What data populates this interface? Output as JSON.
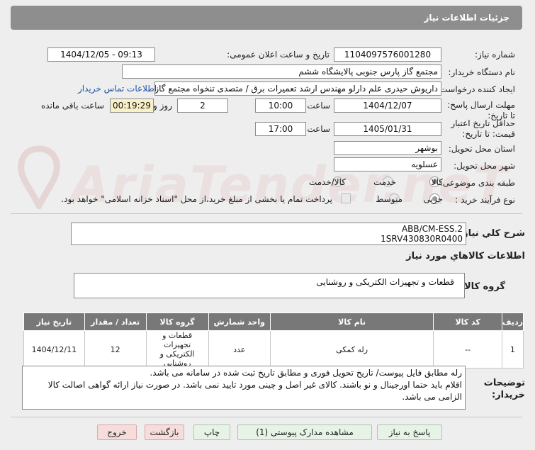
{
  "header": {
    "title": "جزئیات اطلاعات نیاز"
  },
  "fields": {
    "need_number_label": "شماره نیاز:",
    "need_number": "1104097576001280",
    "announce_label": "تاریخ و ساعت اعلان عمومی:",
    "announce_value": "1404/12/05 - 09:13",
    "buyer_org_label": "نام دستگاه خریدار:",
    "buyer_org": "مجتمع گاز پارس جنوبی  پالایشگاه ششم",
    "creator_label": "ایجاد کننده درخواست:",
    "creator": "داریوش حیدری علم دارلو مهندس ارشد تعمیرات برق / متصدی تنخواه مجتمع گاز",
    "contact_link": "اطلاعات تماس خریدار",
    "deadline_label": "مهلت ارسال پاسخ: تا تاریخ:",
    "deadline_date": "1404/12/07",
    "time_label": "ساعت",
    "deadline_time": "10:00",
    "days_value": "2",
    "days_label": "روز و",
    "remaining_time": "00:19:29",
    "remaining_label": "ساعت باقی مانده",
    "validity_label": "حداقل تاریخ اعتبار قیمت: تا تاریخ:",
    "validity_date": "1405/01/31",
    "validity_time": "17:00",
    "province_label": "استان محل تحویل:",
    "province": "بوشهر",
    "city_label": "شهر محل تحویل:",
    "city": "عسلویه",
    "category_label": "طبقه بندی موضوعی:",
    "category_options": [
      "کالا",
      "خدمت",
      "کالا/خدمت"
    ],
    "process_label": "نوع فرآیند خرید :",
    "process_options": [
      "جزیی",
      "متوسط"
    ],
    "payment_note": "پرداخت تمام یا بخشی از مبلغ خرید،از محل \"اسناد خزانه اسلامی\" خواهد بود."
  },
  "description": {
    "label": "شرح کلي نياز:",
    "line1": "ABB/CM-ESS.2",
    "line2": "1SRV430830R0400"
  },
  "goods_section": {
    "title": "اطلاعات کالاهاي مورد نياز"
  },
  "goods_group": {
    "label": "گروه کالا:",
    "value": "قطعات و تجهیزات الکتریکی و روشنایی"
  },
  "table": {
    "headers": [
      "ردیف",
      "کد کالا",
      "نام کالا",
      "واحد شمارش",
      "گروه کالا",
      "تعداد / مقدار",
      "تاریخ نیاز"
    ],
    "rows": [
      {
        "row": "1",
        "code": "--",
        "name": "رله کمکی",
        "unit": "عدد",
        "group": "قطعات و تجهیزات الکتریکی و روشنایی",
        "qty": "12",
        "date": "1404/12/11"
      }
    ]
  },
  "buyer_notes": {
    "label": "توضیحات خریدار:",
    "line1": "رله مطابق فایل پیوست/ تاریخ تحویل فوری و مطابق تاریخ ثبت شده در سامانه می باشد.",
    "line2": "اقلام باید حتما اورجینال و نو باشند. کالای غیر اصل و چینی مورد تایید نمی باشد. در صورت نیاز ارائه گواهی اصالت کالا",
    "line3": "الزامی می باشد."
  },
  "buttons": {
    "reply": "پاسخ به نیاز",
    "attachments": "مشاهده مدارک پیوستی (1)",
    "print": "چاپ",
    "back": "بازگشت",
    "exit": "خروج"
  },
  "watermark": {
    "text": "AriaTender.neT"
  }
}
